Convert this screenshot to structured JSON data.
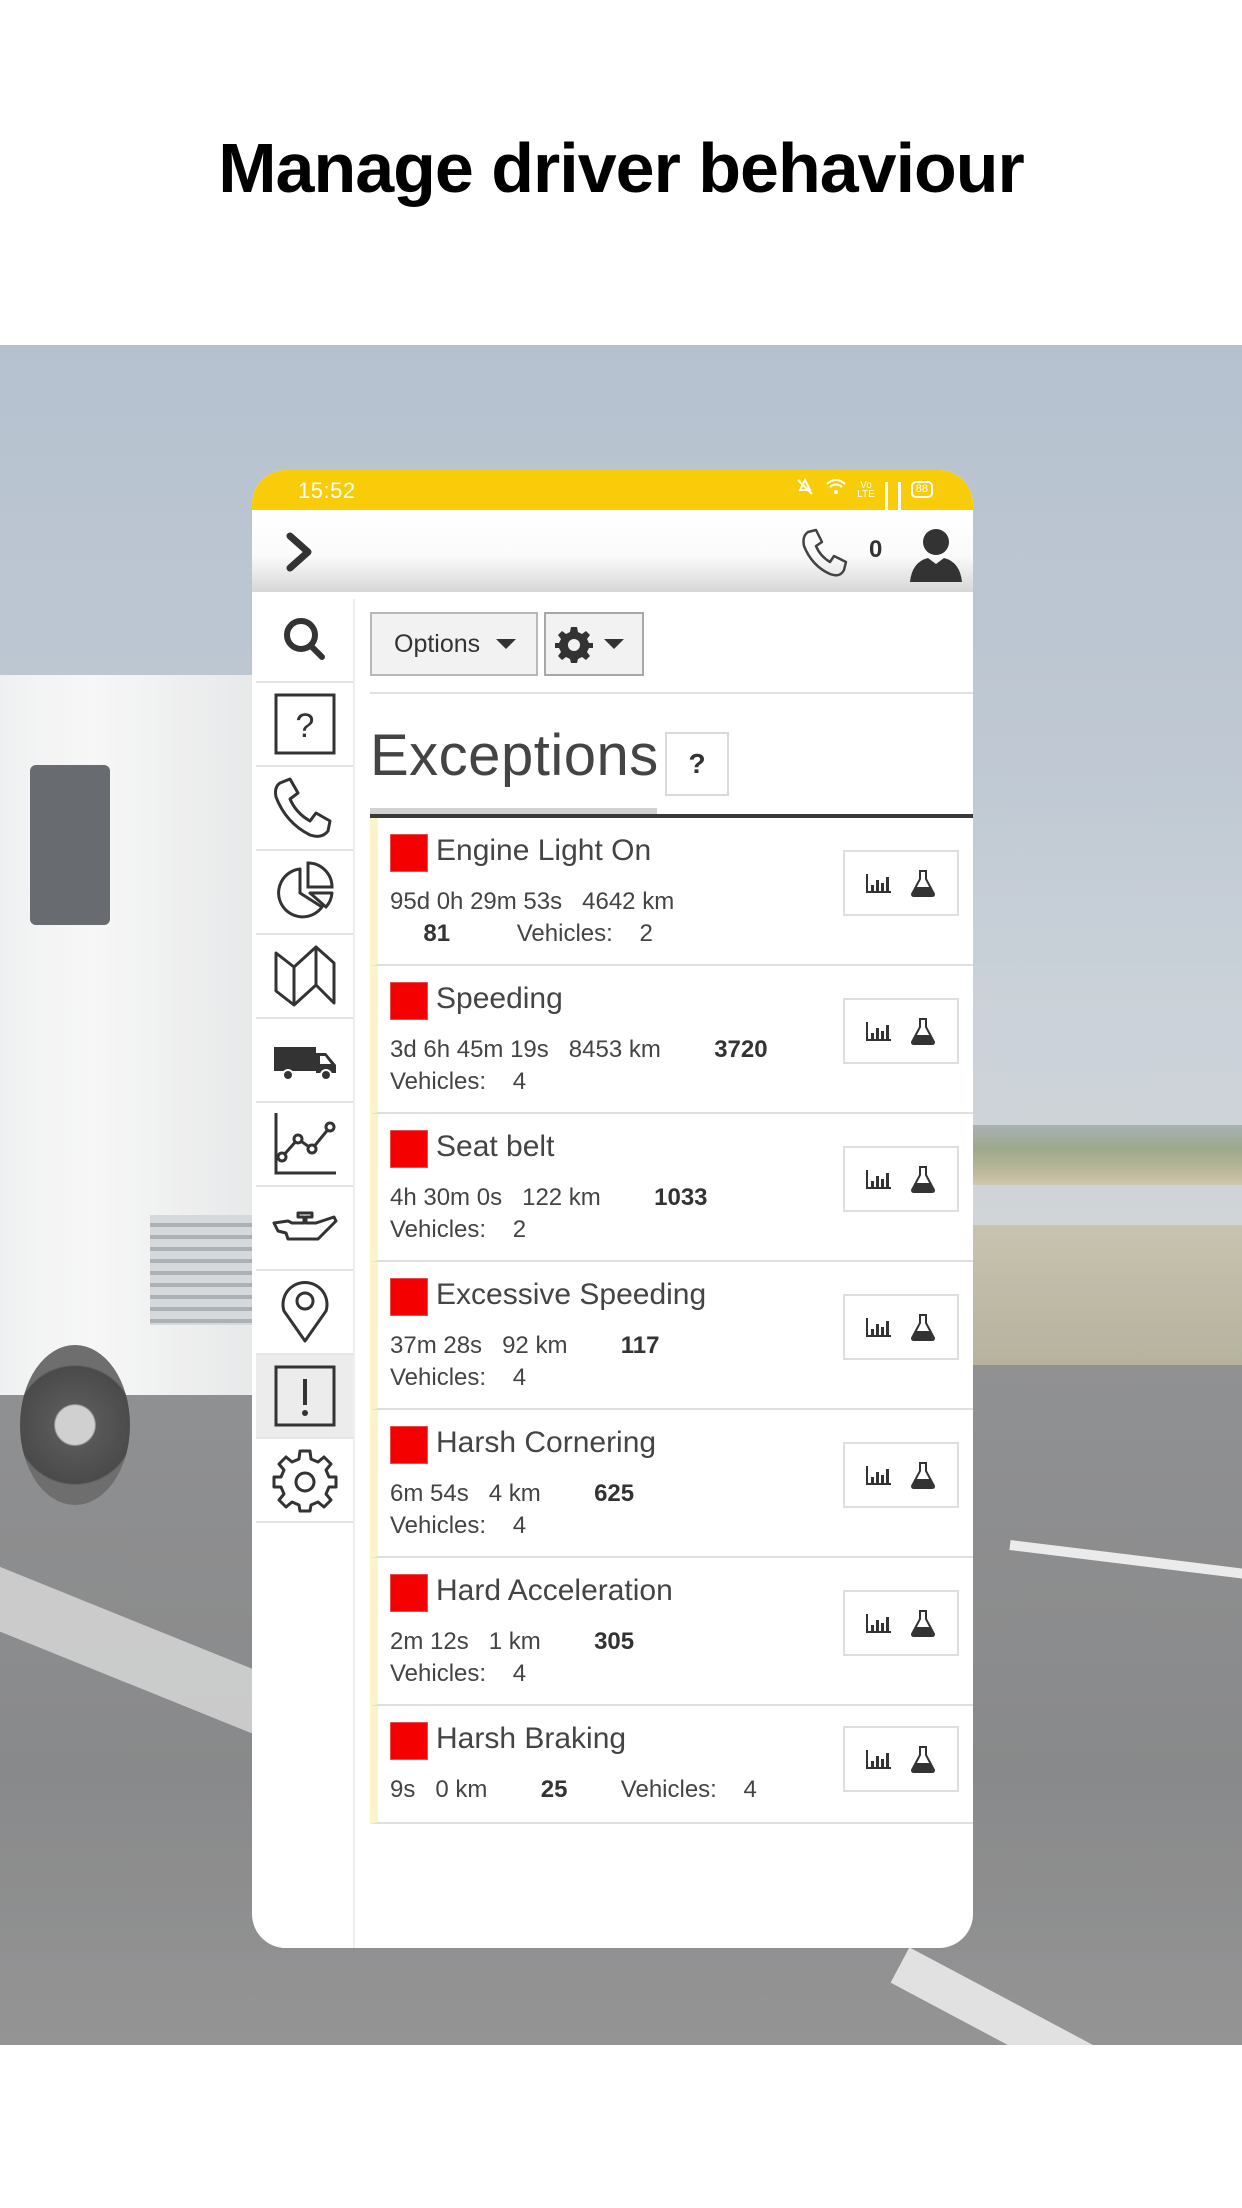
{
  "headline": "Manage driver behaviour",
  "status_bar": {
    "time": "15:52",
    "battery": "88",
    "icons": [
      "mute-icon",
      "wifi-icon",
      "volte-icon",
      "signal-icon",
      "signal-roaming-icon",
      "battery-icon"
    ]
  },
  "app_bar": {
    "expand_icon": "chevron-right-icon",
    "call_icon": "phone-icon",
    "call_count": "0",
    "user_icon": "user-icon"
  },
  "sidebar": {
    "items": [
      {
        "icon": "search-icon",
        "active": false
      },
      {
        "icon": "help-icon",
        "active": false
      },
      {
        "icon": "phone-icon",
        "active": false
      },
      {
        "icon": "pie-chart-icon",
        "active": false
      },
      {
        "icon": "map-icon",
        "active": false
      },
      {
        "icon": "truck-icon",
        "active": false
      },
      {
        "icon": "line-chart-icon",
        "active": false
      },
      {
        "icon": "oil-can-icon",
        "active": false
      },
      {
        "icon": "location-pin-icon",
        "active": false
      },
      {
        "icon": "exceptions-icon",
        "active": true
      },
      {
        "icon": "settings-icon",
        "active": false
      }
    ]
  },
  "toolbar": {
    "options_label": "Options",
    "gear_icon": "gear-icon"
  },
  "page": {
    "title": "Exceptions",
    "help_label": "?"
  },
  "exceptions": [
    {
      "name": "Engine Light On",
      "duration": "95d 0h 29m 53s",
      "distance": "4642 km",
      "count": "81",
      "vehicles_label": "Vehicles:",
      "vehicles": "2",
      "color": "#f50000"
    },
    {
      "name": "Speeding",
      "duration": "3d 6h 45m 19s",
      "distance": "8453 km",
      "count": "3720",
      "vehicles_label": "Vehicles:",
      "vehicles": "4",
      "color": "#f50000"
    },
    {
      "name": "Seat belt",
      "duration": "4h 30m 0s",
      "distance": "122 km",
      "count": "1033",
      "vehicles_label": "Vehicles:",
      "vehicles": "2",
      "color": "#f50000"
    },
    {
      "name": "Excessive Speeding",
      "duration": "37m 28s",
      "distance": "92 km",
      "count": "117",
      "vehicles_label": "Vehicles:",
      "vehicles": "4",
      "color": "#f50000"
    },
    {
      "name": "Harsh Cornering",
      "duration": "6m 54s",
      "distance": "4 km",
      "count": "625",
      "vehicles_label": "Vehicles:",
      "vehicles": "4",
      "color": "#f50000"
    },
    {
      "name": "Hard Acceleration",
      "duration": "2m 12s",
      "distance": "1 km",
      "count": "305",
      "vehicles_label": "Vehicles:",
      "vehicles": "4",
      "color": "#f50000"
    },
    {
      "name": "Harsh Braking",
      "duration": "9s",
      "distance": "0 km",
      "count": "25",
      "vehicles_label": "Vehicles:",
      "vehicles": "4",
      "color": "#f50000"
    }
  ],
  "colors": {
    "status_bar": "#f9cc0a",
    "exception_swatch": "#f50000",
    "row_accent": "#fbf3c9"
  }
}
